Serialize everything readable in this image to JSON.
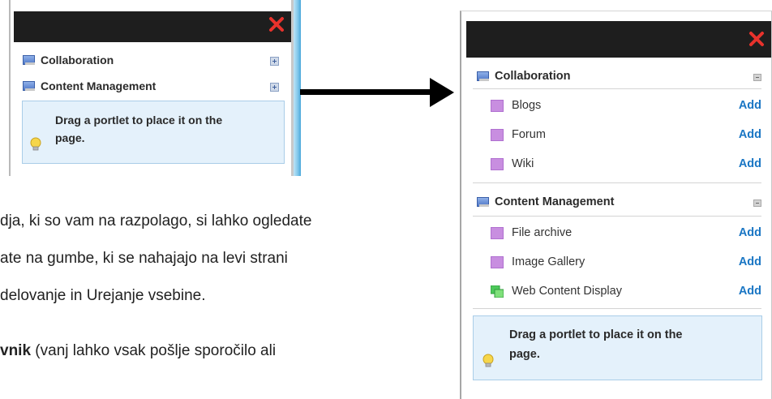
{
  "left_panel": {
    "categories": [
      {
        "label": "Collaboration"
      },
      {
        "label": "Content Management"
      }
    ],
    "tip_line1": "Drag a portlet to place it on the",
    "tip_line2": "page."
  },
  "body_text": {
    "line1": "dja, ki so vam na razpolago, si lahko ogledate",
    "line2": "ate na gumbe, ki se nahajajo na levi strani",
    "line3": "delovanje in Urejanje vsebine.",
    "line4_bold": "vnik",
    "line4_rest": " (vanj lahko vsak pošlje sporočilo ali"
  },
  "right_panel": {
    "categories": [
      {
        "label": "Collaboration",
        "items": [
          {
            "label": "Blogs",
            "action": "Add",
            "icon": "purple-square"
          },
          {
            "label": "Forum",
            "action": "Add",
            "icon": "purple-square"
          },
          {
            "label": "Wiki",
            "action": "Add",
            "icon": "purple-square"
          }
        ]
      },
      {
        "label": "Content Management",
        "items": [
          {
            "label": "File archive",
            "action": "Add",
            "icon": "purple-square"
          },
          {
            "label": "Image Gallery",
            "action": "Add",
            "icon": "purple-square"
          },
          {
            "label": "Web Content Display",
            "action": "Add",
            "icon": "green-square"
          }
        ]
      }
    ],
    "tip_line1": "Drag a portlet to place it on the",
    "tip_line2": "page."
  },
  "colors": {
    "header_bg": "#1e1e1e",
    "close_red": "#e8322c",
    "add_link": "#1a76c4",
    "tip_bg": "#e4f1fb",
    "tip_border": "#a9cde8"
  }
}
